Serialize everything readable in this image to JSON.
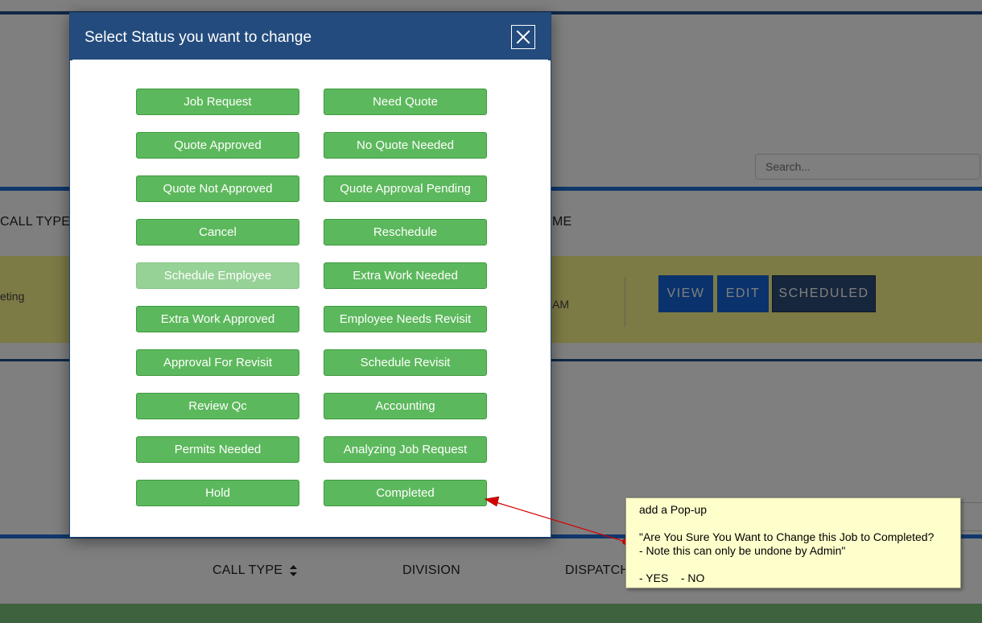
{
  "background": {
    "search_placeholder": "Search...",
    "header_calltype": "CALL TYPE",
    "header_me": "ME",
    "row_text_left": "eting",
    "row_text_right": "AM",
    "view_label": "VIEW",
    "edit_label": "EDIT",
    "scheduled_label": "SCHEDULED",
    "footer_calltype": "CALL TYPE",
    "footer_division": "DIVISION",
    "footer_dispatch": "DISPATCH"
  },
  "modal": {
    "title": "Select Status you want to change",
    "close_icon": "close-icon",
    "statuses": [
      {
        "label": "Job Request",
        "enabled": true
      },
      {
        "label": "Need Quote",
        "enabled": true
      },
      {
        "label": "Quote Approved",
        "enabled": true
      },
      {
        "label": "No Quote Needed",
        "enabled": true
      },
      {
        "label": "Quote Not Approved",
        "enabled": true
      },
      {
        "label": "Quote Approval Pending",
        "enabled": true
      },
      {
        "label": "Cancel",
        "enabled": true
      },
      {
        "label": "Reschedule",
        "enabled": true
      },
      {
        "label": "Schedule Employee",
        "enabled": false
      },
      {
        "label": "Extra Work Needed",
        "enabled": true
      },
      {
        "label": "Extra Work Approved",
        "enabled": true
      },
      {
        "label": "Employee Needs Revisit",
        "enabled": true
      },
      {
        "label": "Approval For Revisit",
        "enabled": true
      },
      {
        "label": "Schedule Revisit",
        "enabled": true
      },
      {
        "label": "Review Qc",
        "enabled": true
      },
      {
        "label": "Accounting",
        "enabled": true
      },
      {
        "label": "Permits Needed",
        "enabled": true
      },
      {
        "label": "Analyzing Job Request",
        "enabled": true
      },
      {
        "label": "Hold",
        "enabled": true
      },
      {
        "label": "Completed",
        "enabled": true
      }
    ]
  },
  "annotation": {
    "line1": "add a Pop-up",
    "line2": "\"Are You Sure You Want to Change this Job to Completed?",
    "line3": "- Note this can only be undone by Admin\"",
    "line4": "- YES    - NO"
  },
  "colors": {
    "modal_header": "#234b7d",
    "status_green": "#5cb85c",
    "status_disabled": "#96d196",
    "note_bg": "#ffffcc",
    "arrow": "#d40000"
  }
}
